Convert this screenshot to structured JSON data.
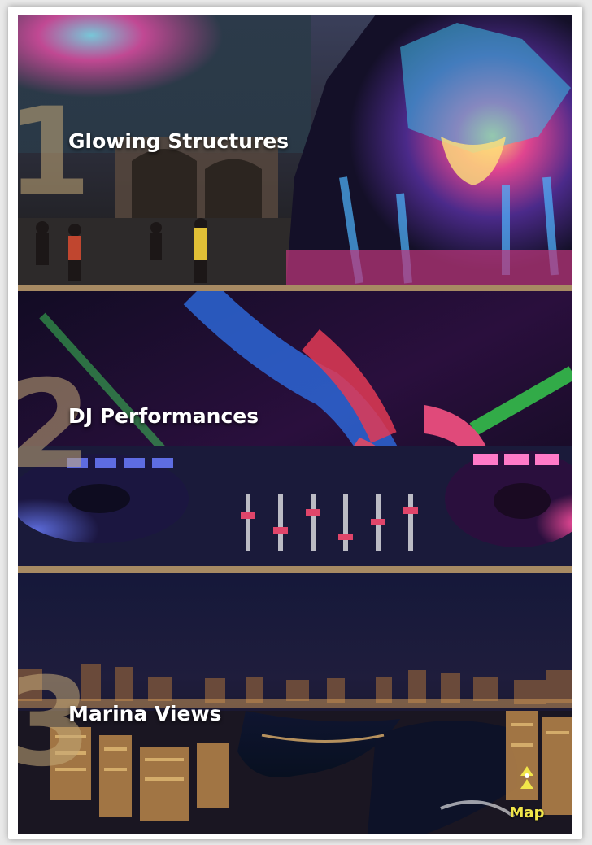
{
  "attractions": [
    {
      "number": "1",
      "title": "Glowing Structures"
    },
    {
      "number": "2",
      "title": "DJ Performances"
    },
    {
      "number": "3",
      "title": "Marina Views"
    }
  ],
  "map_button": {
    "label": "Map",
    "icon": "map-pin-icon"
  },
  "colors": {
    "separator": "#a78a63",
    "number_overlay": "#c4aa78",
    "map_label": "#f1e64a"
  }
}
